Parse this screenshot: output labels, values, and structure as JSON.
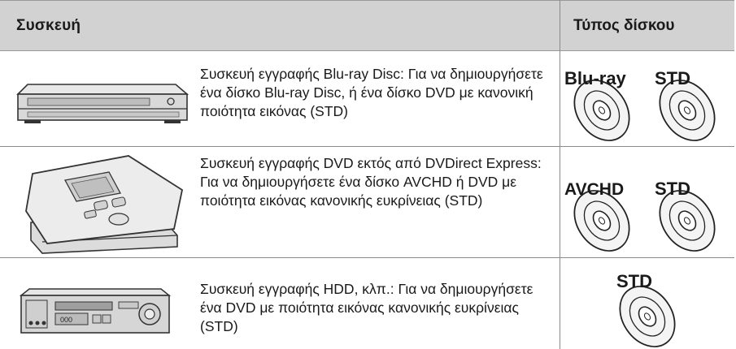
{
  "header": {
    "device_col": "Συσκευή",
    "disc_col": "Τύπος δίσκου"
  },
  "rows": [
    {
      "device_icon": "bluray-recorder-icon",
      "description": "Συσκευή εγγραφής Blu-ray Disc: Για να δημιουργήσετε ένα δίσκο Blu-ray Disc, ή ένα δίσκο DVD με κανονική ποιότητα εικόνας (STD)",
      "discs": [
        "Blu-ray",
        "STD"
      ]
    },
    {
      "device_icon": "dvd-writer-icon",
      "description": "Συσκευή εγγραφής DVD εκτός από DVDirect Express: Για να δημιουργήσετε ένα δίσκο AVCHD ή DVD με ποιότητα εικόνας κανονικής ευκρίνειας (STD)",
      "discs": [
        "AVCHD",
        "STD"
      ]
    },
    {
      "device_icon": "hdd-recorder-icon",
      "description": "Συσκευή εγγραφής HDD, κλπ.: Για να δημιουργήσετε ένα DVD με ποιότητα εικόνας κανονικής ευκρίνειας (STD)",
      "discs": [
        "STD"
      ]
    }
  ]
}
